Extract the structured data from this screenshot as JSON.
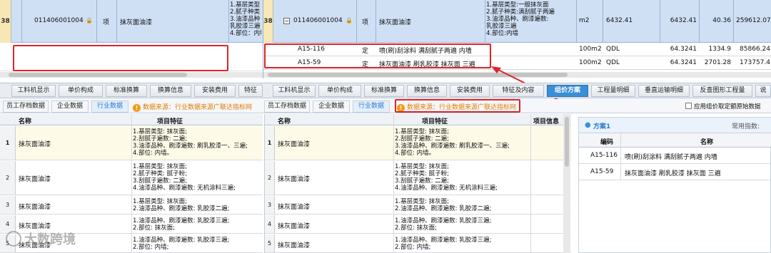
{
  "top_left": {
    "row_num": "38",
    "code": "011406001004",
    "kind": "项",
    "name": "抹灰面油漆",
    "features": "1.基层类型\n2.腻子种类\n3.油漆品种\n乳胶漆三遍\n4.部位：内墙"
  },
  "top_right": {
    "row_num": "38",
    "code": "011406001004",
    "kind": "项",
    "name": "抹灰面油漆",
    "features": "1.基层类型:一般抹灰面\n2.腻子种类:满刮腻子两遍\n3.油漆品种、刷漆遍数:\n乳胶漆三遍\n4.部位:内墙",
    "unit": "m2",
    "qty_expr": "6432.41",
    "qty": "6432.41",
    "price": "40.36",
    "total": "259612.07",
    "subitems": [
      {
        "code": "A15-116",
        "kind": "定",
        "name": "喷(刷)刮涂料 满刮腻子两遍 内墙",
        "unit": "100m2",
        "qty_expr": "QDL",
        "qty": "64.3241",
        "price": "1334.9",
        "total": "85866.24"
      },
      {
        "code": "A15-59",
        "kind": "定",
        "name": "抹灰面油漆 刷乳胶漆 抹灰面 三遍",
        "unit": "100m2",
        "qty_expr": "QDL",
        "qty": "64.3241",
        "price": "2701.28",
        "total": "173757.4"
      }
    ]
  },
  "left_tabs": [
    "工料机显示",
    "单价构成",
    "标准换算",
    "换算信息",
    "安装费用",
    "特征"
  ],
  "right_tabs": [
    "工料机显示",
    "单价构成",
    "标准换算",
    "换算信息",
    "安装费用",
    "特征及内容",
    "组价方案",
    "工程量明细",
    "垂直运输明细",
    "反查图形工程量",
    "说"
  ],
  "left_subtabs": [
    "员工存档数据",
    "企业数据",
    "行业数据"
  ],
  "right_subtabs": [
    "员工存档数据",
    "企业数据",
    "行业数据"
  ],
  "left_warning": "数据来源：行业数据来源广联达指标网",
  "right_warning": "数据来源：行业数据来源广联达指标网",
  "grid_headers": {
    "name": "名称",
    "feature": "项目特征",
    "info": "项目信息"
  },
  "grid_rows": [
    {
      "num": "1",
      "name": "抹灰面油漆",
      "feature": "1.基层类型: 抹灰面;\n2.刮腻子遍数: 二遍;\n3.油漆品种、刷漆遍数: 刷乳胶漆一、三遍;\n4.部位: 内墙。"
    },
    {
      "num": "2",
      "name": "抹灰面油漆",
      "feature": "1.基层类型: 抹灰面;\n2.腻子种类: 腻子粉;\n3.刮腻子遍数: 二遍;\n4.油漆品种、刷漆遍数: 无机涂料三遍;"
    },
    {
      "num": "3",
      "name": "抹灰面油漆",
      "feature": "1.基层类型: 抹灰面;\n2.油漆品种、刷漆遍数: 乳胶漆二遍;"
    },
    {
      "num": "4",
      "name": "抹灰面油漆",
      "feature": "1.油漆品种、刷漆遍数: 乳胶漆三遍;\n2.部位: 抹灰面;"
    },
    {
      "num": "5",
      "name": "抹灰面油漆",
      "feature": "1.油漆品种、刷漆遍数: 乳胶漆三遍;\n2.部位: 内墙;"
    }
  ],
  "scheme_panel": {
    "checkbox_label": "应用组价取定额原始数据",
    "title": "方案1",
    "common_index_label": "常用指数:",
    "headers": [
      "编码",
      "名称"
    ],
    "rows": [
      {
        "code": "A15-116",
        "name": "喷(刷)刮涂料 满刮腻子两遍 内墙"
      },
      {
        "code": "A15-59",
        "name": "抹灰面油漆 刷乳胶漆 抹灰面 三遍"
      }
    ]
  },
  "watermark": "大数跨境",
  "colors": {
    "accent": "#3b8fd8",
    "highlight_row": "#cfe0f5",
    "warning": "#e07c00",
    "annotation": "#e0232a"
  }
}
